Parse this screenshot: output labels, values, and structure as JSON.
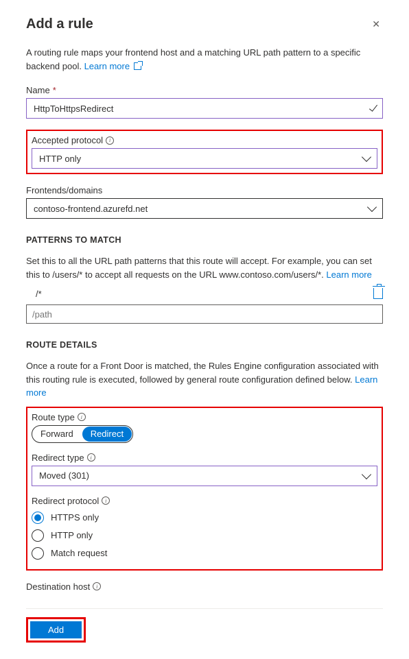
{
  "title": "Add a rule",
  "intro_text": "A routing rule maps your frontend host and a matching URL path pattern to a specific backend pool. ",
  "learn_more": "Learn more",
  "name": {
    "label": "Name",
    "value": "HttpToHttpsRedirect"
  },
  "accepted_protocol": {
    "label": "Accepted protocol",
    "value": "HTTP only"
  },
  "frontends": {
    "label": "Frontends/domains",
    "value": "contoso-frontend.azurefd.net"
  },
  "patterns": {
    "section": "PATTERNS TO MATCH",
    "desc": "Set this to all the URL path patterns that this route will accept. For example, you can set this to /users/* to accept all requests on the URL www.contoso.com/users/*. ",
    "item": "/*",
    "placeholder": "/path"
  },
  "route_details": {
    "section": "ROUTE DETAILS",
    "desc": "Once a route for a Front Door is matched, the Rules Engine configuration associated with this routing rule is executed, followed by general route configuration defined below. ",
    "route_type": {
      "label": "Route type",
      "opt_forward": "Forward",
      "opt_redirect": "Redirect",
      "selected": "Redirect"
    },
    "redirect_type": {
      "label": "Redirect type",
      "value": "Moved (301)"
    },
    "redirect_protocol": {
      "label": "Redirect protocol",
      "options": {
        "https": "HTTPS only",
        "http": "HTTP only",
        "match": "Match request"
      },
      "selected": "HTTPS only"
    },
    "dest_host": {
      "label": "Destination host"
    }
  },
  "footer": {
    "add": "Add"
  }
}
